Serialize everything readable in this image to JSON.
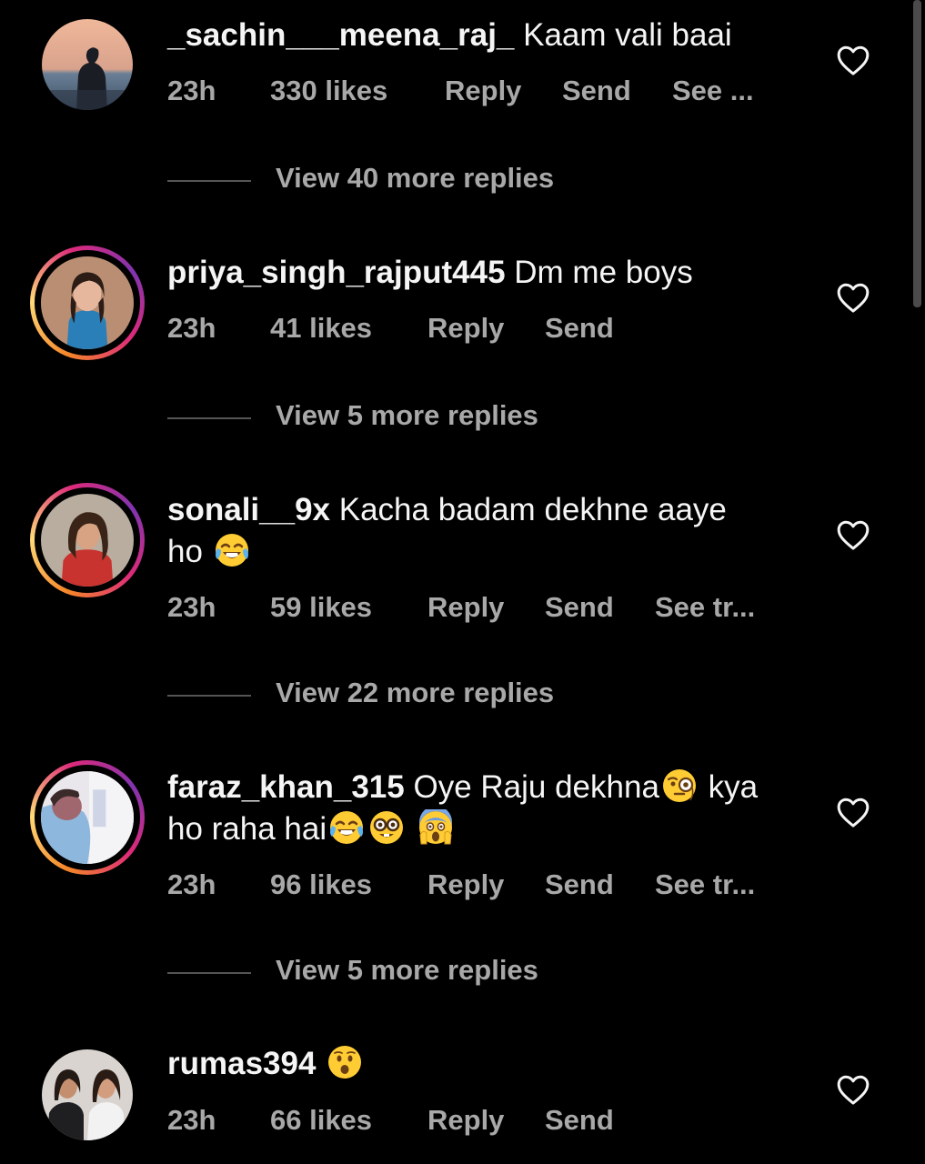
{
  "comments": [
    {
      "username": "_sachin___meena_raj_",
      "text_line1": "Kaam vali baai",
      "text_line2": "",
      "time": "23h",
      "likes": "330 likes",
      "reply": "Reply",
      "send": "Send",
      "see_translation": "See ...",
      "view_replies": "View 40 more replies",
      "has_story": false
    },
    {
      "username": "priya_singh_rajput445",
      "text_line1": "Dm me boys",
      "text_line2": "",
      "time": "23h",
      "likes": "41 likes",
      "reply": "Reply",
      "send": "Send",
      "see_translation": "",
      "view_replies": "View 5 more replies",
      "has_story": true
    },
    {
      "username": "sonali__9x",
      "text_line1": "Kacha badam dekhne aaye",
      "text_line2": "ho",
      "emojis": [
        "face-with-tears-of-joy"
      ],
      "time": "23h",
      "likes": "59 likes",
      "reply": "Reply",
      "send": "Send",
      "see_translation": "See tr...",
      "view_replies": "View 22 more replies",
      "has_story": true
    },
    {
      "username": "faraz_khan_315",
      "text_line1": "Oye Raju dekhna",
      "text_line1_after": "kya",
      "text_line2": "ho raha hai",
      "emojis": [
        "face-with-monocle",
        "face-with-tears-of-joy",
        "nerd-face",
        "face-screaming-in-fear"
      ],
      "time": "23h",
      "likes": "96 likes",
      "reply": "Reply",
      "send": "Send",
      "see_translation": "See tr...",
      "view_replies": "View 5 more replies",
      "has_story": true
    },
    {
      "username": "rumas394",
      "text_line1": "",
      "text_line2": "",
      "emojis": [
        "hushed-face"
      ],
      "time": "23h",
      "likes": "66 likes",
      "reply": "Reply",
      "send": "Send",
      "see_translation": "",
      "view_replies": "",
      "has_story": false
    }
  ],
  "icons": {
    "like": "heart-outline-icon"
  },
  "colors": {
    "background": "#000000",
    "primary_text": "#f5f5f5",
    "secondary_text": "#a8a8a8"
  }
}
